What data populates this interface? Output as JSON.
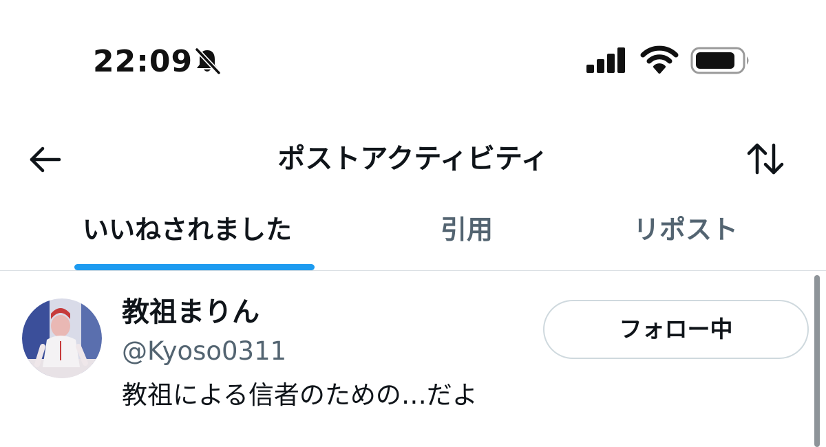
{
  "status_bar": {
    "time": "22:09",
    "icons": [
      "bell-slash-icon",
      "cellular-signal-icon",
      "wifi-icon",
      "battery-icon"
    ]
  },
  "header": {
    "title": "ポストアクティビティ",
    "back_icon": "arrow-left-icon",
    "sort_icon": "sort-arrows-icon"
  },
  "tabs": [
    {
      "label": "いいねされました",
      "active": true
    },
    {
      "label": "引用",
      "active": false
    },
    {
      "label": "リポスト",
      "active": false
    }
  ],
  "users": [
    {
      "name": "教祖まりん",
      "handle": "@Kyoso0311",
      "bio": "教祖による信者のための…だよ",
      "follow_label": "フォロー中"
    }
  ],
  "colors": {
    "accent": "#1d9bf0",
    "text_primary": "#0f1419",
    "text_secondary": "#536471",
    "border": "#cfd9de"
  }
}
